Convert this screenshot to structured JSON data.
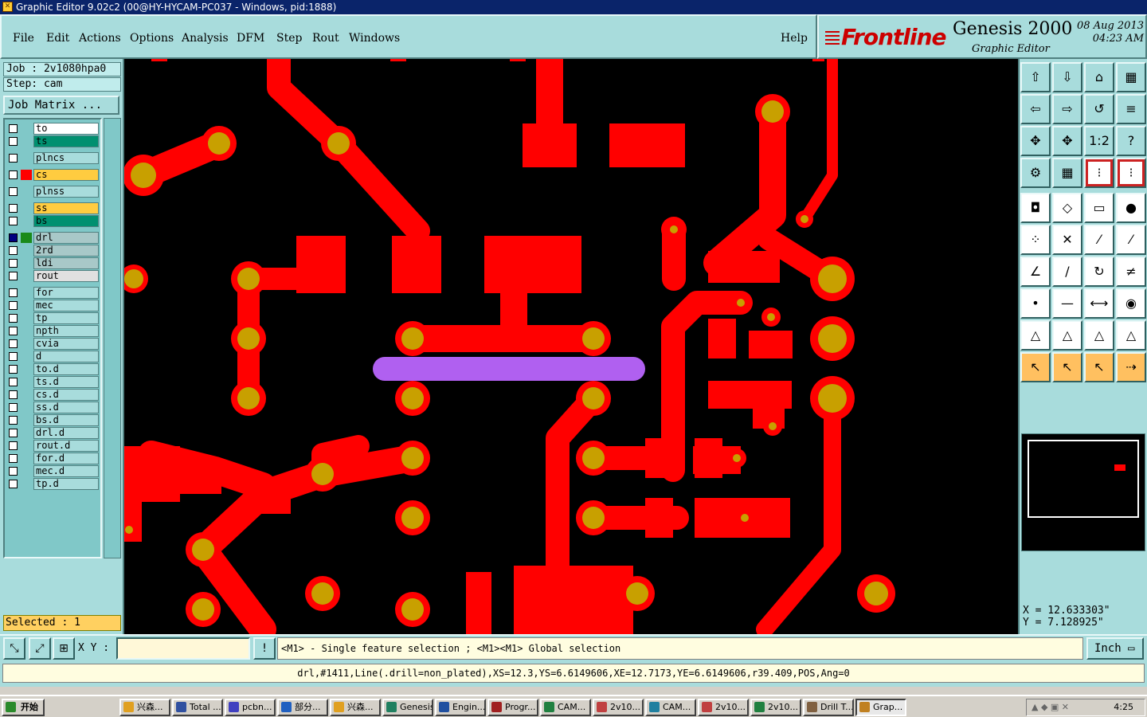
{
  "window": {
    "title": "Graphic Editor 9.02c2 (00@HY-HYCAM-PC037 - Windows, pid:1888)"
  },
  "menu": {
    "items": [
      "File",
      "Edit",
      "Actions",
      "Options",
      "Analysis",
      "DFM",
      "Step",
      "Rout",
      "Windows"
    ],
    "help": "Help"
  },
  "brand": {
    "logo": "Frontline",
    "product": "Genesis 2000",
    "subtitle": "Graphic Editor",
    "date": "08  Aug  2013",
    "time": "04:23  AM"
  },
  "job": {
    "job_line": "Job : 2v1080hpa0",
    "step_line": "Step: cam",
    "matrix_button": "Job Matrix ..."
  },
  "layers": [
    {
      "name": "to",
      "color": "#ffffff",
      "swatch": ""
    },
    {
      "name": "ts",
      "color": "#009070",
      "swatch": ""
    },
    {
      "name": "plncs",
      "color": "#a8dcdc",
      "swatch": ""
    },
    {
      "name": "cs",
      "color": "#ffcc40",
      "swatch": "#ff0000"
    },
    {
      "name": "plnss",
      "color": "#a8dcdc",
      "swatch": ""
    },
    {
      "name": "ss",
      "color": "#ffcc40",
      "swatch": ""
    },
    {
      "name": "bs",
      "color": "#009070",
      "swatch": ""
    },
    {
      "name": "drl",
      "color": "#a8c8c8",
      "swatch": "#1a8a1a"
    },
    {
      "name": "2rd",
      "color": "#a8c8c8",
      "swatch": ""
    },
    {
      "name": "ldi",
      "color": "#a8c8c8",
      "swatch": ""
    },
    {
      "name": "rout",
      "color": "#e0e0e0",
      "swatch": ""
    },
    {
      "name": "for",
      "color": "#a8dcdc",
      "swatch": ""
    },
    {
      "name": "mec",
      "color": "#a8dcdc",
      "swatch": ""
    },
    {
      "name": "tp",
      "color": "#a8dcdc",
      "swatch": ""
    },
    {
      "name": "npth",
      "color": "#a8dcdc",
      "swatch": ""
    },
    {
      "name": "cvia",
      "color": "#a8dcdc",
      "swatch": ""
    },
    {
      "name": "d",
      "color": "#a8dcdc",
      "swatch": ""
    },
    {
      "name": "to.d",
      "color": "#a8dcdc",
      "swatch": ""
    },
    {
      "name": "ts.d",
      "color": "#a8dcdc",
      "swatch": ""
    },
    {
      "name": "cs.d",
      "color": "#a8dcdc",
      "swatch": ""
    },
    {
      "name": "ss.d",
      "color": "#a8dcdc",
      "swatch": ""
    },
    {
      "name": "bs.d",
      "color": "#a8dcdc",
      "swatch": ""
    },
    {
      "name": "drl.d",
      "color": "#a8dcdc",
      "swatch": ""
    },
    {
      "name": "rout.d",
      "color": "#a8dcdc",
      "swatch": ""
    },
    {
      "name": "for.d",
      "color": "#a8dcdc",
      "swatch": ""
    },
    {
      "name": "mec.d",
      "color": "#a8dcdc",
      "swatch": ""
    },
    {
      "name": "tp.d",
      "color": "#a8dcdc",
      "swatch": ""
    }
  ],
  "status": {
    "selected": "Selected : 1"
  },
  "coords": {
    "x": "X  =  12.633303\"",
    "y": "Y  =  7.128925\""
  },
  "command": {
    "xy_label": "X Y :",
    "xy_value": "",
    "prompt": "<M1> - Single feature selection ; <M1><M1> Global selection",
    "unit": "Inch"
  },
  "info": {
    "feature": "drl,#1411,Line(.drill=non_plated),XS=12.3,YS=6.6149606,XE=12.7173,YE=6.6149606,r39.409,POS,Ang=0"
  },
  "colors": {
    "copper": "#ff0000",
    "pad": "#c8a000",
    "selected_feature": "#b060f0",
    "panel": "#a8dcdc"
  },
  "taskbar": {
    "start": "开始",
    "tasks": [
      "兴森...",
      "Total ...",
      "pcbn...",
      "部分...",
      "兴森...",
      "Genesis",
      "Engin...",
      "Progr...",
      "CAM...",
      "2v10...",
      "CAM...",
      "2v10...",
      "2v10...",
      "Drill T...",
      "Grap..."
    ],
    "clock": "4:25"
  }
}
